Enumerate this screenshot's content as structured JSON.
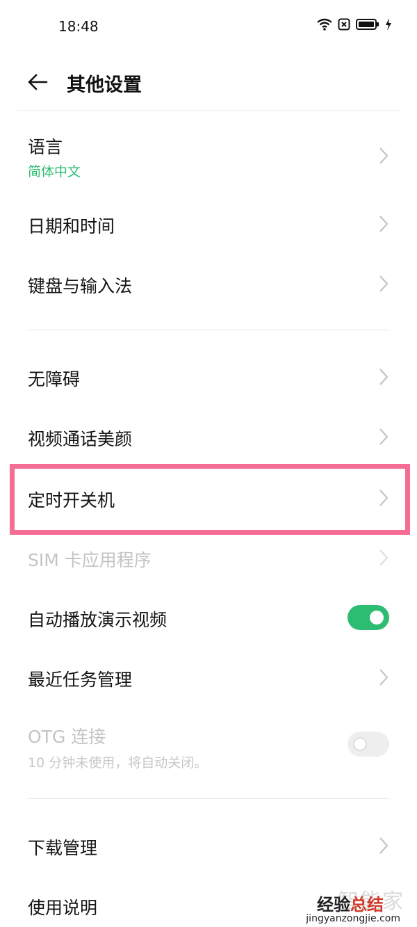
{
  "status_bar": {
    "time": "18:48"
  },
  "header": {
    "title": "其他设置"
  },
  "colors": {
    "accent": "#2dbd72",
    "highlight": "#f56c95",
    "disabled": "#c4c4c4"
  },
  "items": [
    {
      "label": "语言",
      "sub": "简体中文"
    },
    {
      "label": "日期和时间"
    },
    {
      "label": "键盘与输入法"
    },
    {
      "label": "无障碍"
    },
    {
      "label": "视频通话美颜"
    },
    {
      "label": "定时开关机"
    },
    {
      "label": "SIM 卡应用程序",
      "disabled": true
    },
    {
      "label": "自动播放演示视频",
      "toggle": "on"
    },
    {
      "label": "最近任务管理"
    },
    {
      "label": "OTG 连接",
      "sub": "10 分钟未使用，将自动关闭。",
      "disabled": true,
      "toggle": "off"
    },
    {
      "label": "下载管理"
    },
    {
      "label": "使用说明"
    }
  ],
  "watermark": {
    "ghost": "智能家",
    "main_a": "经验",
    "main_b": "总结",
    "url": "jingyanzongjie.com"
  }
}
